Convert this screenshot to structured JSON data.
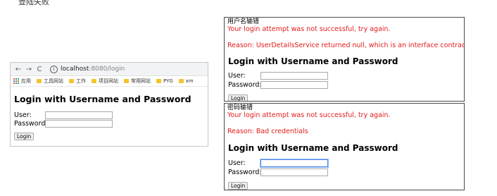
{
  "top_caption": "登陆失败",
  "browser": {
    "back_label": "←",
    "forward_label": "→",
    "reload_label": "C",
    "info_label": "i",
    "url_host": "localhost",
    "url_rest": ":8080/login",
    "bookmarks": [
      "应用",
      "工具网站",
      "工作",
      "项目网站",
      "常用网站",
      "PYG",
      "xm"
    ]
  },
  "login_form": {
    "heading": "Login with Username and Password",
    "user_label": "User:",
    "password_label": "Password:",
    "button_label": "Login",
    "user_value": "",
    "password_value": ""
  },
  "panels": [
    {
      "label": "用户名输错",
      "error": "Your login attempt was not successful, try again.",
      "reason": "Reason: UserDetailsService returned null, which is an interface contract violation"
    },
    {
      "label": "密码输错",
      "error": "Your login attempt was not successful, try again.",
      "reason": "Reason: Bad credentials"
    }
  ]
}
